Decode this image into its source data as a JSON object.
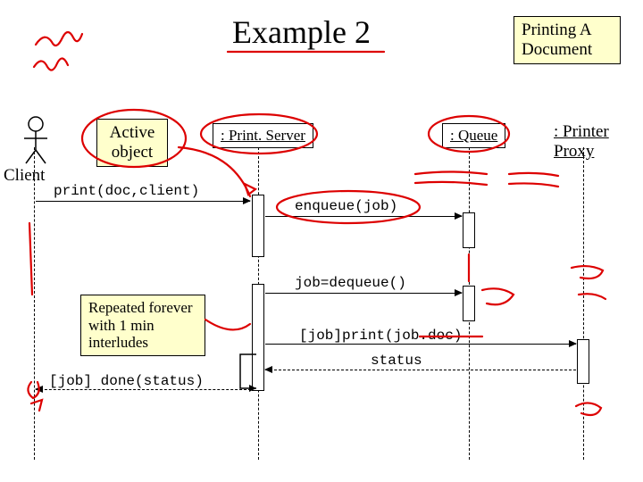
{
  "title": "Example 2",
  "notes": {
    "printing": "Printing A Document",
    "active": "Active object",
    "repeated": "Repeated forever with 1 min interludes",
    "proxy": ": Printer Proxy"
  },
  "actor": {
    "label": "Client"
  },
  "lifelines": {
    "print_server": ": Print. Server",
    "queue": ": Queue"
  },
  "messages": {
    "print": "print(doc,client)",
    "enqueue": "enqueue(job)",
    "dequeue": "job=dequeue()",
    "job_print": "[job]print(job.doc)",
    "done": "[job] done(status)",
    "status": "status"
  }
}
